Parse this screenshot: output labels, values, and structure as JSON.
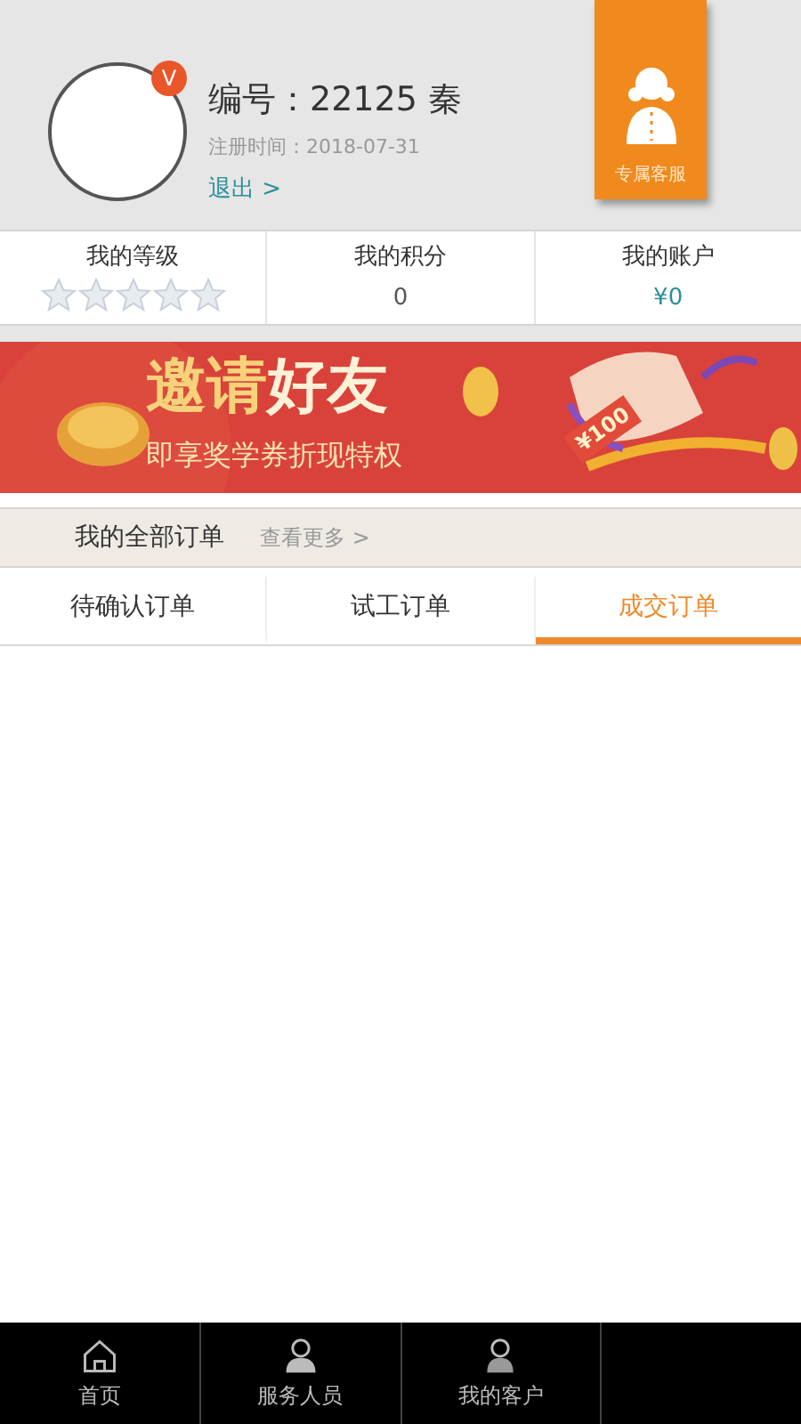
{
  "profile": {
    "badge": "V",
    "id_line": "编号：22125 秦",
    "register_line": "注册时间：2018-07-31",
    "logout": "退出 >"
  },
  "service_button": {
    "label": "专属客服"
  },
  "stats": [
    {
      "kind": "stars",
      "label": "我的等级",
      "stars": 0
    },
    {
      "kind": "text",
      "label": "我的积分",
      "value": "0"
    },
    {
      "kind": "money",
      "label": "我的账户",
      "value": "¥0"
    }
  ],
  "banner": {
    "title_a": "邀请",
    "title_b": "好友",
    "subtitle": "即享奖学券折现特权",
    "ticket": "¥100"
  },
  "orders": {
    "title": "我的全部订单",
    "more": "查看更多 >"
  },
  "tabs": [
    {
      "label": "待确认订单",
      "selected": false
    },
    {
      "label": "试工订单",
      "selected": false
    },
    {
      "label": "成交订单",
      "selected": true
    }
  ],
  "bottom_nav": [
    {
      "kind": "home",
      "label": "首页"
    },
    {
      "kind": "staff",
      "label": "服务人员"
    },
    {
      "kind": "client",
      "label": "我的客户"
    },
    {
      "kind": "hidden"
    }
  ]
}
